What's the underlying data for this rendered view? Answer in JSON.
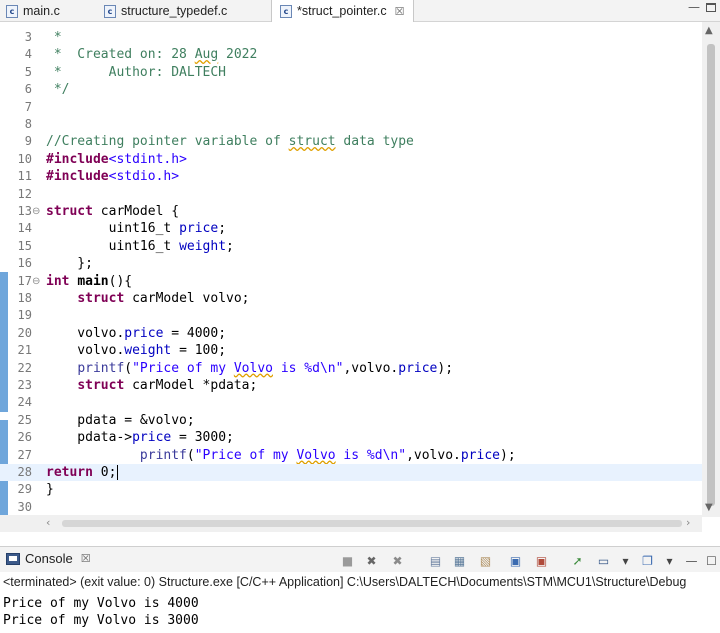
{
  "tabs": [
    {
      "name": "main.c",
      "icon": "c-file-icon"
    },
    {
      "name": "structure_typedef.c",
      "icon": "c-file-icon"
    },
    {
      "name": "*struct_pointer.c",
      "icon": "c-file-icon",
      "active": true
    }
  ],
  "tab_icon_letter": "c",
  "tab_close_glyph": "☒",
  "editor": {
    "current_line": 28,
    "lines": [
      {
        "n": "3",
        "html": "<span class=\"cm\"> *</span>"
      },
      {
        "n": "4",
        "html": "<span class=\"cm\"> *  Created on: 28 <span class=\"wavy\">Aug</span> 2022</span>"
      },
      {
        "n": "5",
        "html": "<span class=\"cm\"> *      Author: DALTECH</span>"
      },
      {
        "n": "6",
        "html": "<span class=\"cm\"> */</span>"
      },
      {
        "n": "7",
        "html": ""
      },
      {
        "n": "8",
        "html": ""
      },
      {
        "n": "9",
        "html": "<span class=\"cm\">//Creating pointer variable of <span class=\"wavy\">struct</span> data type</span>"
      },
      {
        "n": "10",
        "html": "<span class=\"kw\">#include</span><span class=\"st\">&lt;stdint.h&gt;</span>"
      },
      {
        "n": "11",
        "html": "<span class=\"kw\">#include</span><span class=\"st\">&lt;stdio.h&gt;</span>"
      },
      {
        "n": "12",
        "html": ""
      },
      {
        "n": "13",
        "fold": "⊖",
        "html": "<span class=\"kw\">struct</span> carModel {"
      },
      {
        "n": "14",
        "html": "        uint16_t <span class=\"fd\">price</span>;"
      },
      {
        "n": "15",
        "html": "        uint16_t <span class=\"fd\">weight</span>;"
      },
      {
        "n": "16",
        "html": "    };"
      },
      {
        "n": "17",
        "fold": "⊖",
        "html": "<span class=\"kw\">int</span> <b>main</b>(){"
      },
      {
        "n": "18",
        "html": "    <span class=\"kw\">struct</span> carModel volvo;"
      },
      {
        "n": "19",
        "html": ""
      },
      {
        "n": "20",
        "html": "    volvo.<span class=\"fd\">price</span> = 4000;"
      },
      {
        "n": "21",
        "html": "    volvo.<span class=\"fd\">weight</span> = 100;"
      },
      {
        "n": "22",
        "html": "    <span class=\"fn\">printf</span>(<span class=\"st\">\"Price of my <span class=\"wavy\">Volvo</span> is %d\\n\"</span>,volvo.<span class=\"fd\">price</span>);"
      },
      {
        "n": "23",
        "html": "    <span class=\"kw\">struct</span> carModel *pdata;"
      },
      {
        "n": "24",
        "html": ""
      },
      {
        "n": "25",
        "html": "    pdata = &amp;volvo;"
      },
      {
        "n": "26",
        "html": "    pdata-&gt;<span class=\"fd\">price</span> = 3000;"
      },
      {
        "n": "27",
        "html": "            <span class=\"fn\">printf</span>(<span class=\"st\">\"Price of my <span class=\"wavy\">Volvo</span> is %d\\n\"</span>,volvo.<span class=\"fd\">price</span>);"
      },
      {
        "n": "28",
        "html": "<span class=\"kw\">return</span> 0;<span class=\"caret\"></span>"
      },
      {
        "n": "29",
        "html": "}"
      },
      {
        "n": "30",
        "html": ""
      }
    ]
  },
  "console": {
    "title": "Console",
    "status": "<terminated> (exit value: 0) Structure.exe [C/C++ Application] C:\\Users\\DALTECH\\Documents\\STM\\MCU1\\Structure\\Debug",
    "output": [
      "Price of my Volvo is 4000",
      "Price of my Volvo is 3000"
    ],
    "toolbar": [
      {
        "name": "terminate-icon",
        "glyph": "■",
        "color": "#9a9a9a"
      },
      {
        "name": "remove-launch-icon",
        "glyph": "✖",
        "color": "#666666"
      },
      {
        "name": "remove-all-icon",
        "glyph": "✖",
        "color": "#8a8a8a"
      },
      {
        "name": "clear-console-icon",
        "glyph": "▤",
        "color": "#6a7fa0"
      },
      {
        "name": "scroll-lock-icon",
        "glyph": "▦",
        "color": "#5a7a9a"
      },
      {
        "name": "word-wrap-icon",
        "glyph": "▧",
        "color": "#b09060"
      },
      {
        "name": "show-on-stdout-icon",
        "glyph": "▣",
        "color": "#3a6ab0"
      },
      {
        "name": "show-on-stderr-icon",
        "glyph": "▣",
        "color": "#b04a3a"
      },
      {
        "name": "pin-console-icon",
        "glyph": "➚",
        "color": "#3a8a3a"
      },
      {
        "name": "display-console-icon",
        "glyph": "▭",
        "color": "#3a5a8a"
      },
      {
        "name": "display-dropdown-icon",
        "glyph": "▾",
        "color": "#444444"
      },
      {
        "name": "new-console-icon",
        "glyph": "❐",
        "color": "#3a6ab0"
      },
      {
        "name": "new-dropdown-icon",
        "glyph": "▾",
        "color": "#444444"
      },
      {
        "name": "minimize-icon",
        "glyph": "—",
        "color": "#555555"
      },
      {
        "name": "maximize-icon",
        "glyph": "☐",
        "color": "#555555"
      }
    ],
    "tab_close_glyph": "☒"
  },
  "window_controls": {
    "minimize": "—",
    "maximize": ""
  }
}
